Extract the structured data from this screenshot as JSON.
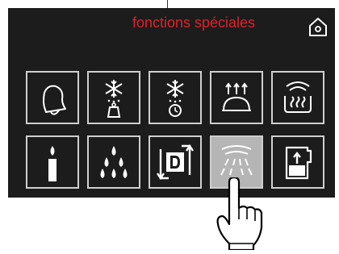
{
  "screen": {
    "title": "fonctions spéciales",
    "colors": {
      "background": "#1c1c1c",
      "title": "#e0202a",
      "tile_border": "#cfcfcf",
      "selected_tile": "#b5b5b5"
    }
  },
  "tiles": [
    {
      "icon": "bell-icon"
    },
    {
      "icon": "defrost-weight-icon"
    },
    {
      "icon": "defrost-time-icon"
    },
    {
      "icon": "proofing-icon"
    },
    {
      "icon": "keep-warm-icon"
    },
    {
      "icon": "candle-icon"
    },
    {
      "icon": "water-drops-icon"
    },
    {
      "icon": "descaling-icon"
    },
    {
      "icon": "rinse-shower-icon",
      "selected": true
    },
    {
      "icon": "fill-water-icon"
    }
  ],
  "home_icon": "home-icon",
  "pointer_icon": "hand-pointer-icon"
}
